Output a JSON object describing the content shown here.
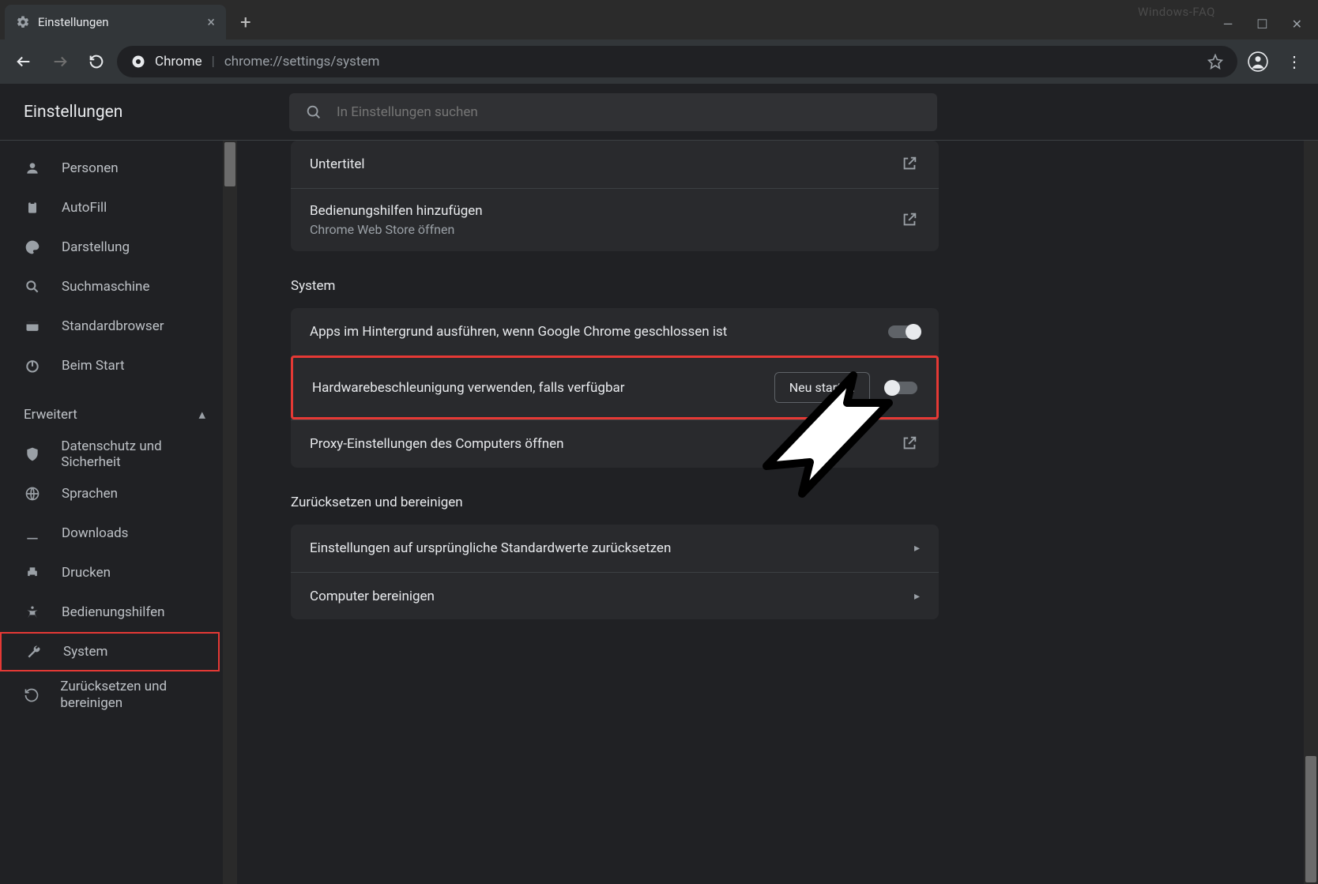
{
  "watermark": "Windows-FAQ",
  "tab": {
    "title": "Einstellungen"
  },
  "address": {
    "scheme_label": "Chrome",
    "url": "chrome://settings/system"
  },
  "header": {
    "title": "Einstellungen"
  },
  "search": {
    "placeholder": "In Einstellungen suchen"
  },
  "sidebar": {
    "items": [
      {
        "label": "Personen"
      },
      {
        "label": "AutoFill"
      },
      {
        "label": "Darstellung"
      },
      {
        "label": "Suchmaschine"
      },
      {
        "label": "Standardbrowser"
      },
      {
        "label": "Beim Start"
      }
    ],
    "advanced_label": "Erweitert",
    "advanced": [
      {
        "label": "Datenschutz und Sicherheit"
      },
      {
        "label": "Sprachen"
      },
      {
        "label": "Downloads"
      },
      {
        "label": "Drucken"
      },
      {
        "label": "Bedienungshilfen"
      },
      {
        "label": "System"
      },
      {
        "label": "Zurücksetzen und bereinigen"
      }
    ]
  },
  "content": {
    "top_card": [
      {
        "title": "Untertitel"
      },
      {
        "title": "Bedienungshilfen hinzufügen",
        "sub": "Chrome Web Store öffnen"
      }
    ],
    "system_title": "System",
    "system_rows": [
      {
        "title": "Apps im Hintergrund ausführen, wenn Google Chrome geschlossen ist",
        "toggle": "on"
      },
      {
        "title": "Hardwarebeschleunigung verwenden, falls verfügbar",
        "button": "Neu starten",
        "toggle": "off",
        "highlight": true
      },
      {
        "title": "Proxy-Einstellungen des Computers öffnen"
      }
    ],
    "reset_title": "Zurücksetzen und bereinigen",
    "reset_rows": [
      {
        "title": "Einstellungen auf ursprüngliche Standardwerte zurücksetzen"
      },
      {
        "title": "Computer bereinigen"
      }
    ]
  }
}
